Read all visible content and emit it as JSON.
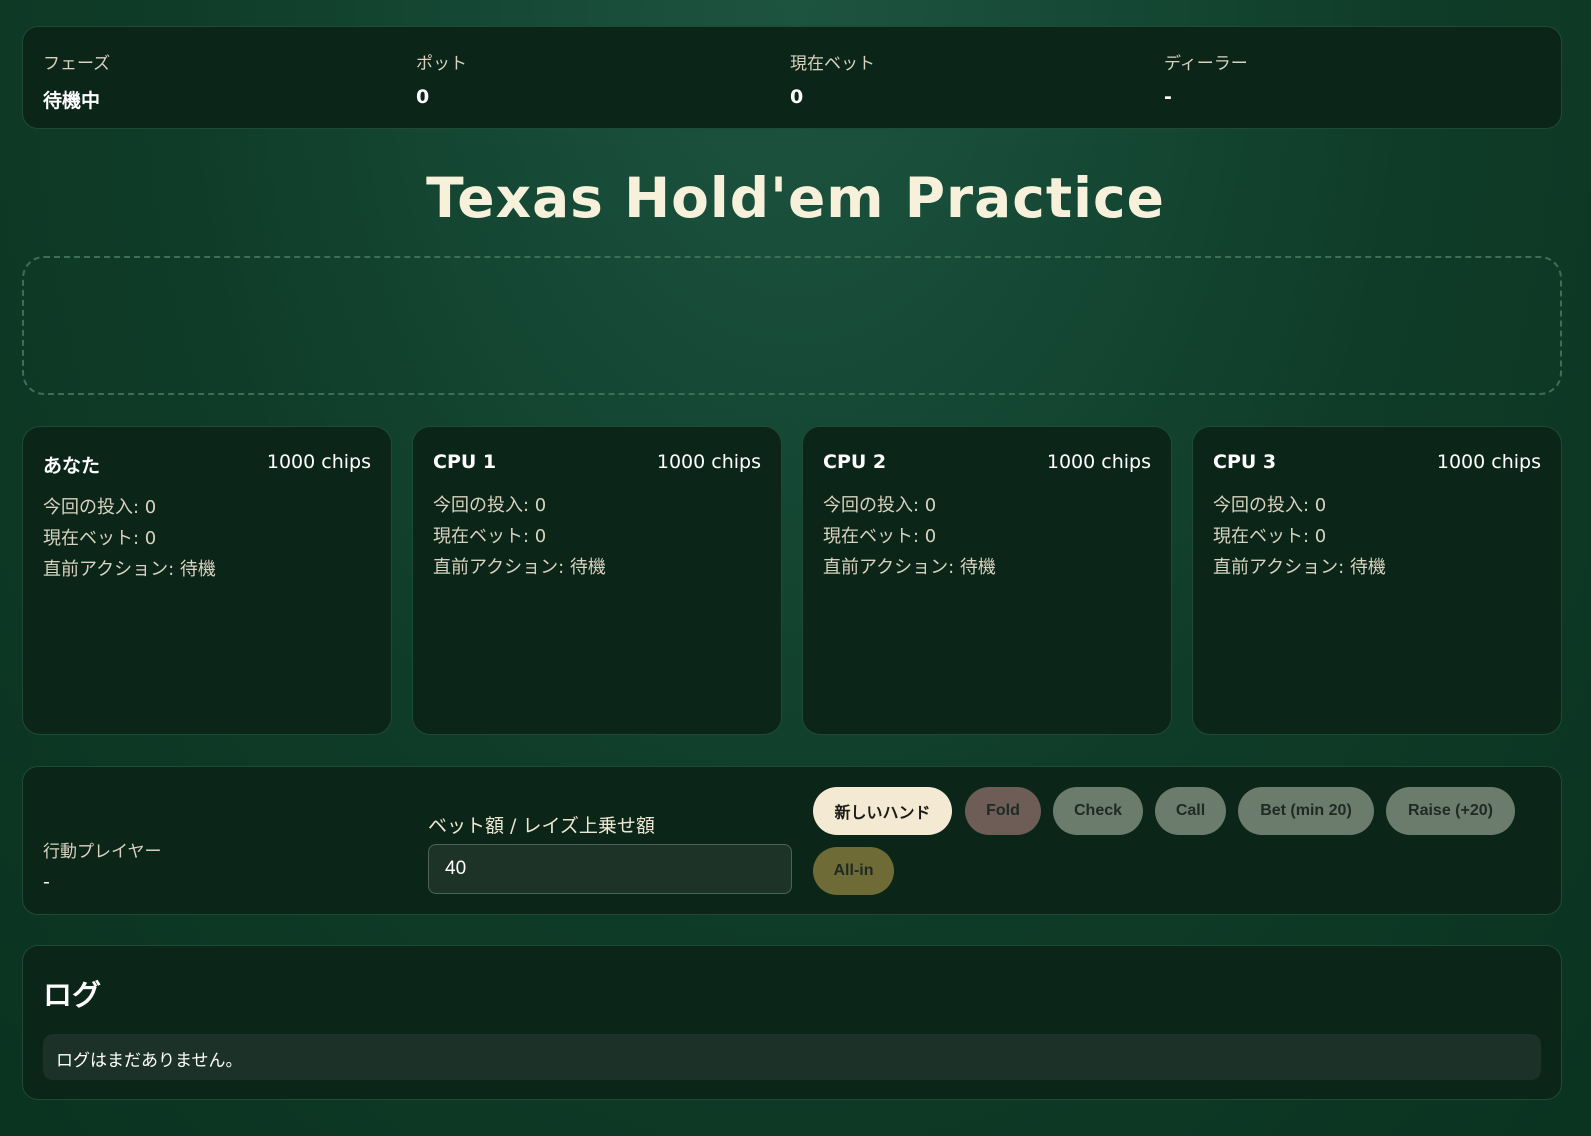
{
  "status": {
    "phase_label": "フェーズ",
    "phase_value": "待機中",
    "pot_label": "ポット",
    "pot_value": "0",
    "current_bet_label": "現在ベット",
    "current_bet_value": "0",
    "dealer_label": "ディーラー",
    "dealer_value": "-"
  },
  "title": "Texas Hold'em Practice",
  "players": [
    {
      "name": "あなた",
      "chips": "1000 chips",
      "contributed": "今回の投入: 0",
      "bet": "現在ベット: 0",
      "last_action": "直前アクション: 待機"
    },
    {
      "name": "CPU 1",
      "chips": "1000 chips",
      "contributed": "今回の投入: 0",
      "bet": "現在ベット: 0",
      "last_action": "直前アクション: 待機"
    },
    {
      "name": "CPU 2",
      "chips": "1000 chips",
      "contributed": "今回の投入: 0",
      "bet": "現在ベット: 0",
      "last_action": "直前アクション: 待機"
    },
    {
      "name": "CPU 3",
      "chips": "1000 chips",
      "contributed": "今回の投入: 0",
      "bet": "現在ベット: 0",
      "last_action": "直前アクション: 待機"
    }
  ],
  "controls": {
    "actor_label": "行動プレイヤー",
    "actor_value": "-",
    "bet_label": "ベット額 / レイズ上乗せ額",
    "bet_value": "40",
    "buttons": {
      "new_hand": "新しいハンド",
      "fold": "Fold",
      "check": "Check",
      "call": "Call",
      "bet": "Bet (min 20)",
      "raise": "Raise (+20)",
      "allin": "All-in"
    }
  },
  "log": {
    "title": "ログ",
    "empty_message": "ログはまだありません。"
  },
  "colors": {
    "felt": "#0f3c28",
    "panel": "#0b2519",
    "text": "#efe7d2",
    "primary_button": "#f4ead4",
    "fold_button": "#6e5c56",
    "action_button": "#6c7c6c",
    "allin_button": "#6f6b37"
  }
}
